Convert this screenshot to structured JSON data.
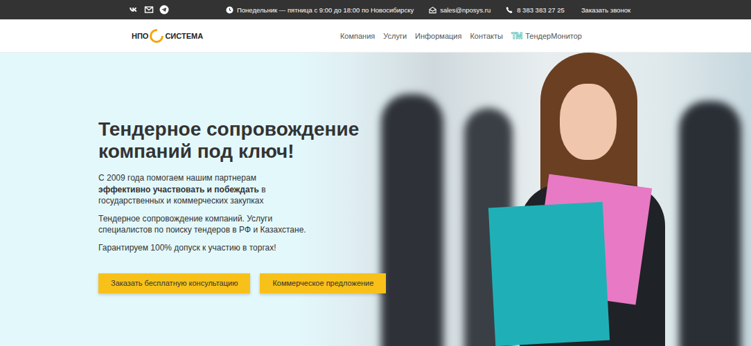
{
  "topbar": {
    "hours": "Понедельник — пятница с 9:00 до 18:00 по Новосибирску",
    "email": "sales@nposys.ru",
    "phone": "8 383 383 27 25",
    "callback": "Заказать звонок"
  },
  "logo": {
    "left": "НПО",
    "right": "СИСТЕМА"
  },
  "nav": [
    {
      "label": "Компания",
      "badge": ""
    },
    {
      "label": "Услуги",
      "badge": ""
    },
    {
      "label": "Информация",
      "badge": ""
    },
    {
      "label": "Контакты",
      "badge": ""
    },
    {
      "label": "ТендерМонитор",
      "badge": "TM"
    }
  ],
  "hero": {
    "title": "Тендерное сопровождение компаний под ключ!",
    "lead_pre": "С 2009 года помогаем нашим партнерам ",
    "lead_bold": "эффективно участвовать и побеждать",
    "lead_post": " в государственных и коммерческих закупках",
    "text": "Тендерное сопровождение компаний. Услуги специалистов по поиску тендеров в РФ и Казахстане.",
    "guarantee": "Гарантируем 100% допуск к участию в торгах!",
    "buttons": [
      "Заказать бесплатную консультацию",
      "Коммерческое предложение"
    ]
  }
}
